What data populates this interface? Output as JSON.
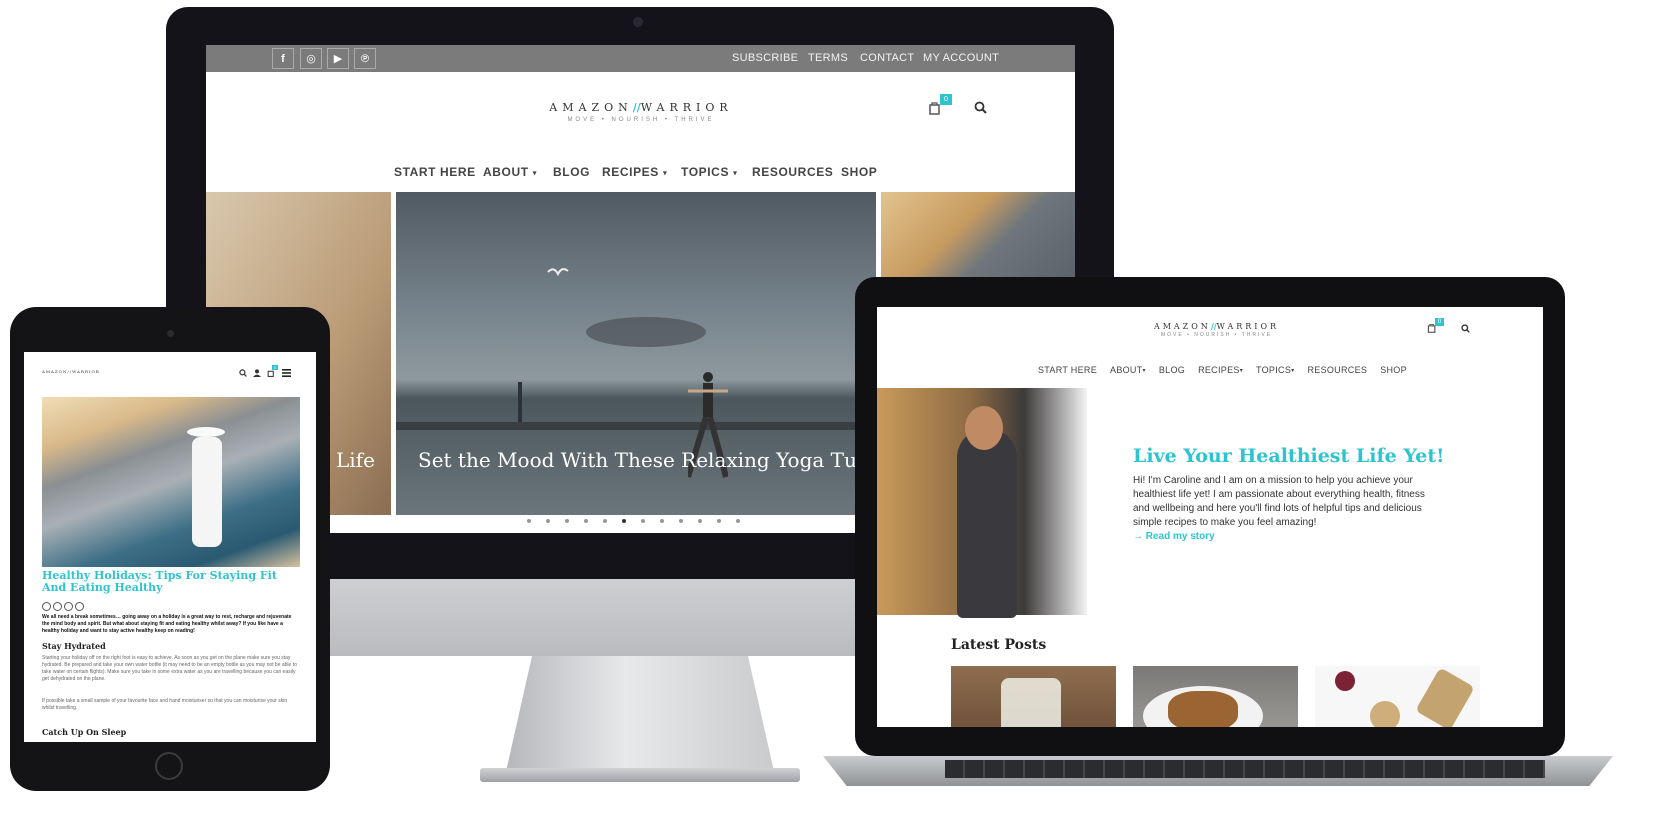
{
  "desktop": {
    "social_icons": [
      "facebook-icon",
      "instagram-icon",
      "youtube-icon",
      "pinterest-icon"
    ],
    "social_glyphs": [
      "f",
      "◎",
      "▶",
      "℗"
    ],
    "top_links": [
      "SUBSCRIBE",
      "TERMS",
      "CONTACT",
      "MY ACCOUNT"
    ],
    "logo": {
      "left": "AMAZON",
      "slash": "//",
      "right": "WARRIOR",
      "tagline": "MOVE  •  NOURISH  •  THRIVE"
    },
    "cart_count": "0",
    "nav": [
      "START HERE",
      "ABOUT",
      "BLOG",
      "RECIPES",
      "TOPICS",
      "RESOURCES",
      "SHOP"
    ],
    "nav_caret": "▾",
    "slider": {
      "left_title": "Life",
      "main_title": "Set the Mood With These Relaxing Yoga Tunes",
      "slide_count": 12,
      "active_slide": 6
    }
  },
  "tablet": {
    "logo": "AMAZON//WARRIOR",
    "cart_count": "0",
    "post_title": "Healthy Holidays: Tips For Staying Fit And Eating Healthy",
    "intro": "We all need a break sometimes… going away on a holiday is a great way to rest, recharge and rejuvenate the mind body and spirit. But what about staying fit and eating healthy whilst away? If you like have a healthy holiday and want to stay active healthy keep on reading!",
    "heading_1": "Stay Hydrated",
    "para_1": "Starting your holiday off on the right foot is easy to achieve. As soon as you get on the plane make sure you stay hydrated. Be prepared and take your own water bottle (it may need to be an empty bottle as you may not be able to take water on certain flights). Make sure you take in some extra water as you are travelling because you can easily get dehydrated on the plane.",
    "para_2": "If possible take a small sample of your favourite face and hand moisturiser so that you can moisturise your skin whilst travelling.",
    "heading_2": "Catch Up On Sleep"
  },
  "laptop": {
    "logo": {
      "left": "AMAZON",
      "slash": "//",
      "right": "WARRIOR",
      "tagline": "MOVE  •  NOURISH  •  THRIVE"
    },
    "cart_count": "0",
    "nav": [
      "START HERE",
      "ABOUT",
      "BLOG",
      "RECIPES",
      "TOPICS",
      "RESOURCES",
      "SHOP"
    ],
    "nav_caret": "▾",
    "hero_title": "Live Your Healthiest Life Yet!",
    "hero_body": "Hi! I'm Caroline and I am on a mission to help you achieve your healthiest life yet!  I am passionate about everything health, fitness and wellbeing and here you'll find lots of helpful tips and delicious simple recipes to make you feel amazing!",
    "hero_link": "→ Read my story",
    "latest_title": "Latest Posts"
  },
  "colors": {
    "accent": "#2ec4cf",
    "topbar": "#7b7b7b",
    "text": "#333333"
  }
}
